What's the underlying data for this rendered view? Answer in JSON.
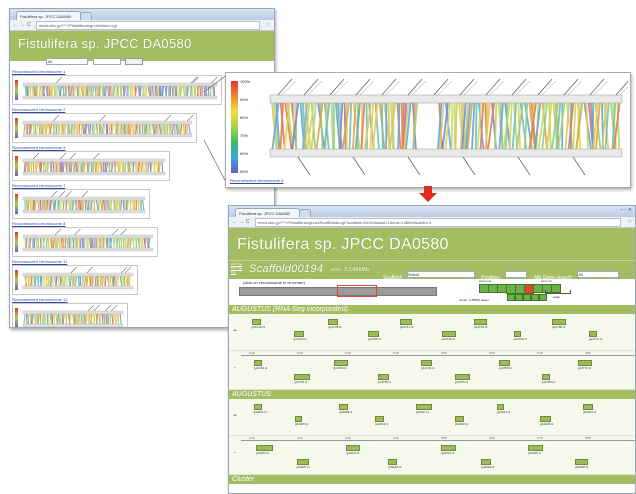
{
  "colors": {
    "accent_green": "#a4bd62",
    "link_blue": "#2a4b9e",
    "arrow_red": "#e02a1c",
    "highlight_red": "#e34234"
  },
  "window1": {
    "tab_title": "Fistulifera sp. JPCC DA0580",
    "url": "medi.cbrc.jp/???/Fistulifera/cgi-bin/index.cgi",
    "header_title": "Fistulifera sp. JPCC DA0580",
    "gene_search_label": "Gene search:",
    "gene_search_value": "All",
    "submit_label": "submit",
    "chromosomes": [
      {
        "label": "Reconstructed chromosome 1"
      },
      {
        "label": "Reconstructed chromosome 2"
      },
      {
        "label": "Reconstructed chromosome 3"
      },
      {
        "label": "Reconstructed chromosome 7"
      },
      {
        "label": "Reconstructed chromosome 8"
      },
      {
        "label": "Reconstructed chromosome 11"
      },
      {
        "label": "Reconstructed chromosome 12"
      }
    ]
  },
  "zoom_panel": {
    "scale_labels": [
      "100%",
      "90%",
      "80%",
      "70%",
      "60%",
      "50%"
    ],
    "link_text": "Reconstructed chromosome 6"
  },
  "window2": {
    "tab_title": "Fistulifera sp. JPCC DA0580",
    "url": "medi.cbrc.jp/???/Fistulifera/cgi-bin/ScaffDetail.cgi?scaffold=00194&start=1&end=148594&width=1",
    "header_title": "Fistulifera sp. JPCC DA0580",
    "side_links": [
      "Chr. Top",
      "Chr. Top",
      "Top"
    ],
    "scaffold_name": "Scaffold00194",
    "scaffold_size": "size: 0.1486Mb",
    "scaffold_label": "Scaffold:",
    "scaffold_select": "Select",
    "position_label": "Position:",
    "mb_search_label": "Mb Gene search:",
    "mb_search_value": "All",
    "click_hint": "(click on chromosome to re-center)",
    "zoom_out_label": "zoom out",
    "zoom_in_label": "zoom in",
    "center_text": "center: 1-88554 bases",
    "scale_text": "scale",
    "sections": [
      {
        "title": "AUGUSTUS (RNA-Seq incorporated)",
        "plus_strand": "+",
        "minus_strand": "-",
        "ticks": [
          "0.10",
          "0.20",
          "0.30",
          "0.40",
          "0.50",
          "0.60",
          "0.70",
          "0.80"
        ],
        "plus_genes": [
          "g14719.t1",
          "g14722.t1",
          "g14735.t1",
          "g14736.t1",
          "g14741.t1",
          "g14745.t1",
          "g14754.t1",
          "g14760.t1",
          "g14768.t1",
          "g14771.t1"
        ],
        "minus_genes": [
          "g14720.t1",
          "g14725.t1",
          "g14730.t1",
          "g14738.t1",
          "g14744.t1",
          "g14750.t1",
          "g14758.t1",
          "g14763.t1",
          "g14770.t1"
        ]
      },
      {
        "title": "AUGUSTUS",
        "plus_strand": "+",
        "minus_strand": "-",
        "ticks": [
          "0.10",
          "0.20",
          "0.30",
          "0.40",
          "0.50",
          "0.60",
          "0.70",
          "0.80"
        ],
        "plus_genes": [
          "g34001.t1",
          "g34005.t1",
          "g34009.t1",
          "g34013.t1",
          "g34017.t1",
          "g34020.t1",
          "g34024.t1",
          "g34028.t1",
          "g34031.t1"
        ],
        "minus_genes": [
          "g34003.t1",
          "g34007.t1",
          "g34011.t1",
          "g34015.t1",
          "g34019.t1",
          "g34022.t1",
          "g34026.t1",
          "g34030.t1"
        ]
      }
    ],
    "footer_section": "Cluster"
  }
}
